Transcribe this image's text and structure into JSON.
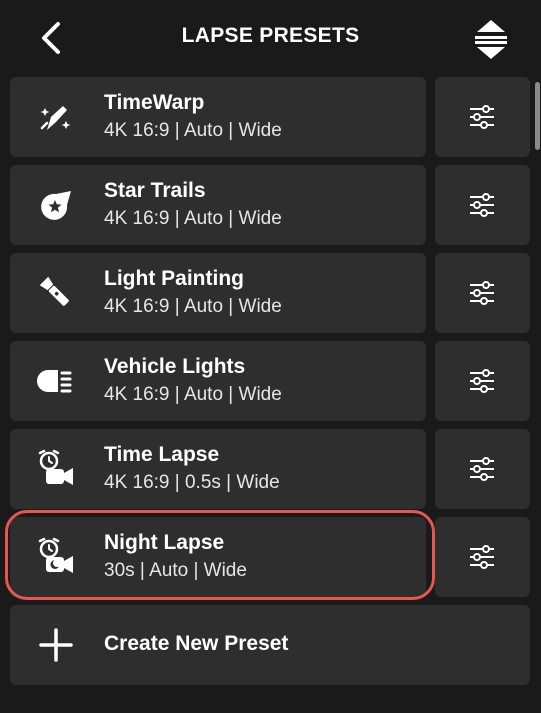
{
  "header": {
    "title": "LAPSE PRESETS",
    "back_icon": "chevron-left-icon",
    "sort_icon": "sort-arrows-icon"
  },
  "presets": [
    {
      "name": "TimeWarp",
      "detail": "4K 16:9 | Auto | Wide",
      "icon": "timewarp-icon"
    },
    {
      "name": "Star Trails",
      "detail": "4K 16:9 | Auto | Wide",
      "icon": "star-trails-icon"
    },
    {
      "name": "Light Painting",
      "detail": "4K 16:9 | Auto | Wide",
      "icon": "flashlight-icon"
    },
    {
      "name": "Vehicle Lights",
      "detail": "4K 16:9 | Auto | Wide",
      "icon": "headlight-icon"
    },
    {
      "name": "Time Lapse",
      "detail": "4K 16:9 | 0.5s | Wide",
      "icon": "time-lapse-icon"
    },
    {
      "name": "Night Lapse",
      "detail": "30s | Auto | Wide",
      "icon": "night-lapse-icon",
      "highlighted": true
    }
  ],
  "create": {
    "label": "Create New Preset",
    "icon": "plus-icon"
  },
  "colors": {
    "background": "#1a1a1a",
    "card": "#2e2e2e",
    "highlight": "#e6574f"
  }
}
